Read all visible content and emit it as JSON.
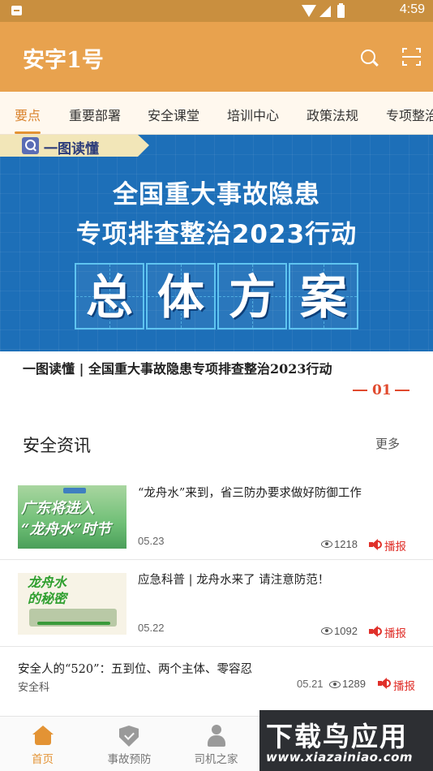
{
  "status_bar": {
    "time": "4:59"
  },
  "app": {
    "title": "安字1号"
  },
  "tabs": [
    {
      "label": "要点",
      "active": true
    },
    {
      "label": "重要部署",
      "active": false
    },
    {
      "label": "安全课堂",
      "active": false
    },
    {
      "label": "培训中心",
      "active": false
    },
    {
      "label": "政策法规",
      "active": false
    },
    {
      "label": "专项整治",
      "active": false
    }
  ],
  "banner": {
    "badge": "一图读懂",
    "line1": "全国重大事故隐患",
    "line2": "专项排查整治2023行动",
    "boxes": [
      "总",
      "体",
      "方",
      "案"
    ],
    "caption": "一图读懂 | 全国重大事故隐患专项排查整治2023行动",
    "page": "01"
  },
  "section": {
    "title": "安全资讯",
    "more": "更多"
  },
  "news": [
    {
      "title": "“龙舟水”来到，省三防办要求做好防御工作",
      "date": "05.23",
      "views": "1218",
      "play": "播报",
      "thumb_text": "广东将进入\n“龙舟水”时节"
    },
    {
      "title": "应急科普 | 龙舟水来了 请注意防范！",
      "date": "05.22",
      "views": "1092",
      "play": "播报",
      "thumb_text": "龙舟水\n的秘密"
    },
    {
      "title": "安全人的“520”：五到位、两个主体、零容忍",
      "source": "安全科",
      "date": "05.21",
      "views": "1289",
      "play": "播报"
    }
  ],
  "bottom_nav": [
    {
      "label": "首页",
      "icon": "home-icon",
      "active": true
    },
    {
      "label": "事故预防",
      "icon": "shield-icon",
      "active": false
    },
    {
      "label": "司机之家",
      "icon": "driver-icon",
      "active": false
    }
  ],
  "watermark": {
    "title": "下载鸟应用",
    "url": "www.xiazainiao.com"
  },
  "colors": {
    "primary": "#e8a24e",
    "status_bar": "#c98f3f",
    "accent": "#e39334",
    "play_red": "#e0302a",
    "banner_blue": "#1d6fb8"
  }
}
